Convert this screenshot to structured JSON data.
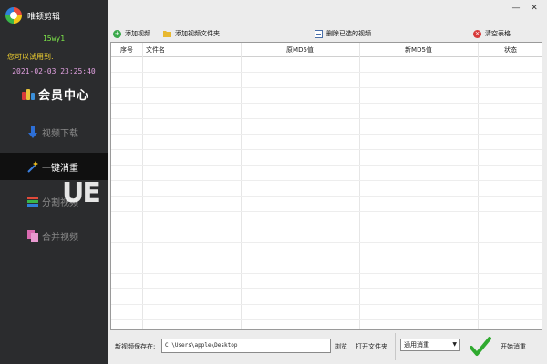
{
  "app": {
    "title": "唯顿剪辑"
  },
  "user": {
    "name": "15wy1",
    "trial_label": "您可以试用到:",
    "trial_date": "2021-02-03 23:25:40"
  },
  "member": {
    "label": "会员中心",
    "icon": "member-emblem-icon"
  },
  "nav": [
    {
      "label": "视频下载",
      "icon": "download-arrow-icon",
      "active": false
    },
    {
      "label": "一键消重",
      "icon": "magic-wand-icon",
      "active": true
    },
    {
      "label": "分割视频",
      "icon": "split-stack-icon",
      "active": false
    },
    {
      "label": "合并视频",
      "icon": "merge-pages-icon",
      "active": false
    }
  ],
  "window": {
    "minimize": "—",
    "close": "✕"
  },
  "toolbar": {
    "add_video": "添加视频",
    "add_folder": "添加视频文件夹",
    "delete_selected": "删除已选的视频",
    "clear_table": "清空表格"
  },
  "table": {
    "columns": [
      "序号",
      "文件名",
      "原MD5值",
      "新MD5值",
      "状态"
    ]
  },
  "bottom": {
    "save_label": "新视频保存在:",
    "save_path": "C:\\Users\\apple\\Desktop",
    "browse": "浏览",
    "open_folder": "打开文件夹",
    "mode": "通用消重",
    "start": "开始消重"
  },
  "watermark": "UE",
  "colors": {
    "sidebar_bg": "#2b2c2e",
    "active_nav_bg": "#101010",
    "user_name": "#7ee84a",
    "trial_label": "#f0d030",
    "trial_date": "#e0a0e0",
    "start_check": "#2faa2f"
  }
}
